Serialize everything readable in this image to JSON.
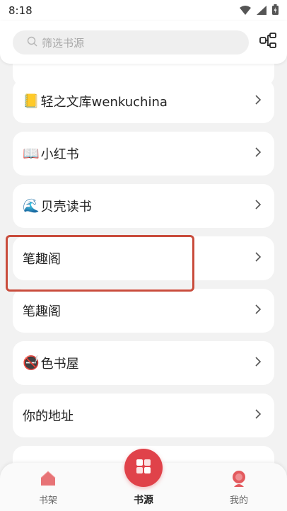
{
  "status": {
    "time": "8:18"
  },
  "search": {
    "placeholder": "筛选书源"
  },
  "colors": {
    "accent": "#e0424a",
    "highlight": "#c94c3c"
  },
  "sources": [
    {
      "emoji": "",
      "label": ""
    },
    {
      "emoji": "📒",
      "label": "轻之文库wenkuchina"
    },
    {
      "emoji": "📖",
      "label": "小红书"
    },
    {
      "emoji": "🌊",
      "label": "贝壳读书"
    },
    {
      "emoji": "",
      "label": "笔趣阁"
    },
    {
      "emoji": "",
      "label": "笔趣阁"
    },
    {
      "emoji": "🚭",
      "label": "色书屋"
    },
    {
      "emoji": "",
      "label": "你的地址"
    },
    {
      "emoji": "",
      "label": ""
    }
  ],
  "nav": {
    "bookshelf": "书架",
    "sources": "书源",
    "mine": "我的"
  }
}
